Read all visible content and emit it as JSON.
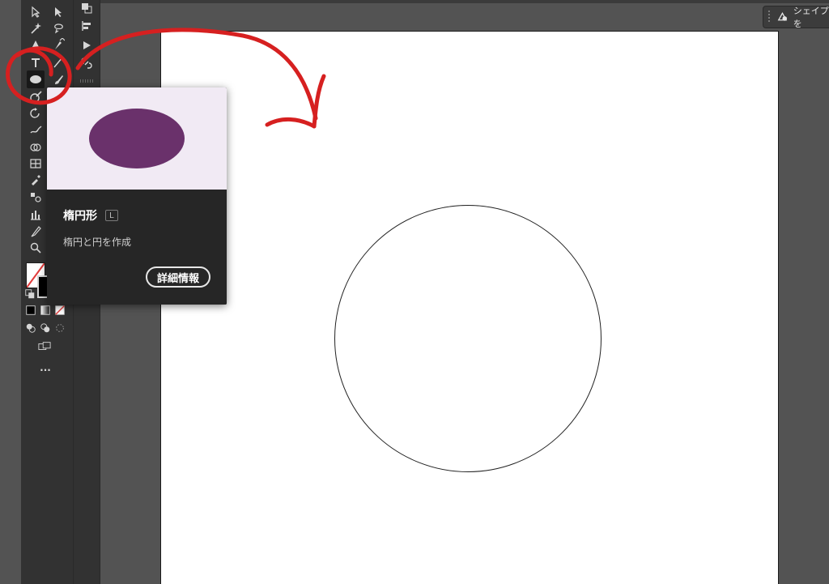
{
  "topbar": {
    "shape_label": "シェイプを"
  },
  "tooltip": {
    "title": "楕円形",
    "shortcut": "L",
    "description": "楕円と円を作成",
    "button": "詳細情報",
    "preview_fill": "#6a316b",
    "preview_bg": "#f1eaf4"
  },
  "toolbar": {
    "selected_tool": "ellipse-tool",
    "more_label": "..."
  },
  "annotation": {
    "color": "#d62020"
  }
}
